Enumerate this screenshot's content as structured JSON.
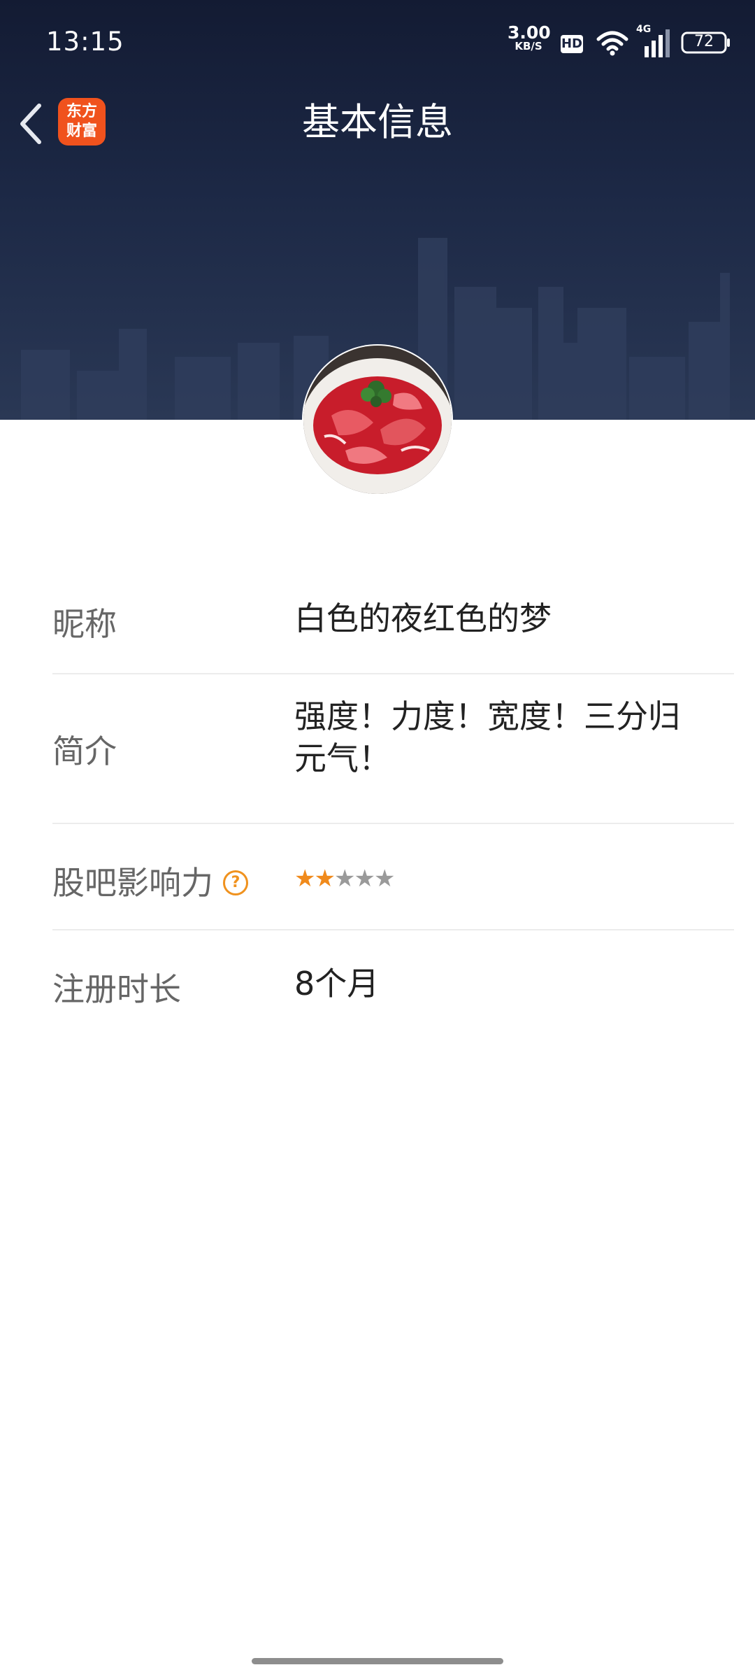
{
  "status_bar": {
    "time": "13:15",
    "net_speed": "3.00",
    "net_speed_unit": "KB/S",
    "hd": "HD",
    "signal_type": "4G",
    "battery": "72"
  },
  "nav": {
    "logo_line1": "东方",
    "logo_line2": "财富",
    "title": "基本信息"
  },
  "profile": {
    "rows": [
      {
        "label": "昵称",
        "value": "白色的夜红色的梦"
      },
      {
        "label": "简介",
        "value": "强度！力度！宽度！三分归元气！"
      },
      {
        "label": "股吧影响力",
        "value": ""
      },
      {
        "label": "注册时长",
        "value": "8个月"
      }
    ],
    "influence_help": "?",
    "influence_rating": 2,
    "influence_max": 5
  },
  "colors": {
    "accent": "#f08a1c",
    "header_bg": "#1c2845",
    "logo_bg": "#f0521d"
  }
}
